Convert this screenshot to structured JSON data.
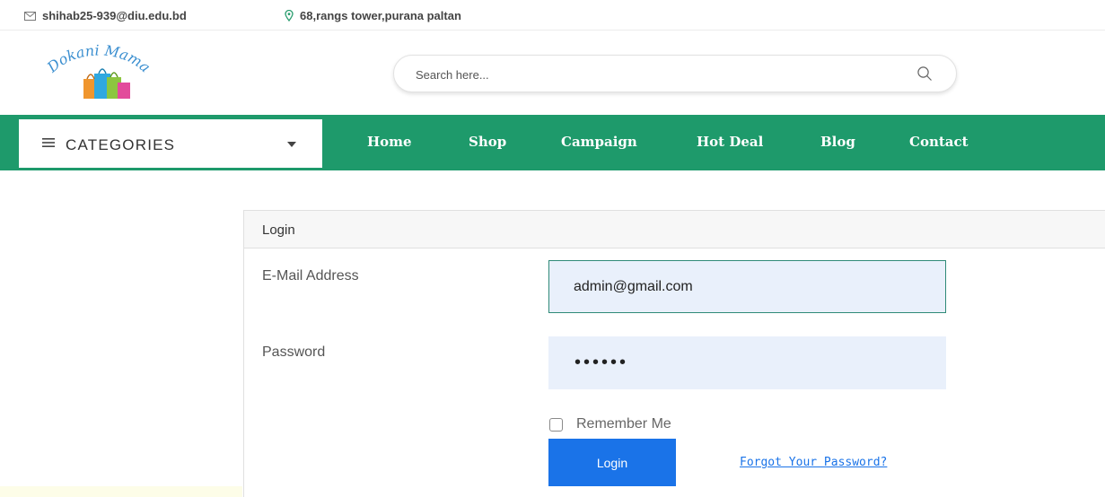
{
  "topbar": {
    "email": "shihab25-939@diu.edu.bd",
    "address": "68,rangs tower,purana paltan",
    "email_icon": "envelope-icon",
    "address_icon": "location-pin-icon"
  },
  "logo": {
    "text": "Dokani Mama"
  },
  "search": {
    "placeholder": "Search here...",
    "icon": "search-icon"
  },
  "nav": {
    "categories_label": "CATEGORIES",
    "links": [
      "Home",
      "Shop",
      "Campaign",
      "Hot Deal",
      "Blog",
      "Contact"
    ]
  },
  "login": {
    "header": "Login",
    "email_label": "E-Mail Address",
    "email_value": "admin@gmail.com",
    "password_label": "Password",
    "password_value": "••••••",
    "remember_label": "Remember Me",
    "remember_checked": false,
    "submit_label": "Login",
    "forgot_label": "Forgot Your Password?"
  },
  "colors": {
    "nav_bg": "#1e9a6b",
    "button_bg": "#1a73e8",
    "input_bg": "#e9f0fb",
    "input_focus_border": "#2f8a78"
  }
}
